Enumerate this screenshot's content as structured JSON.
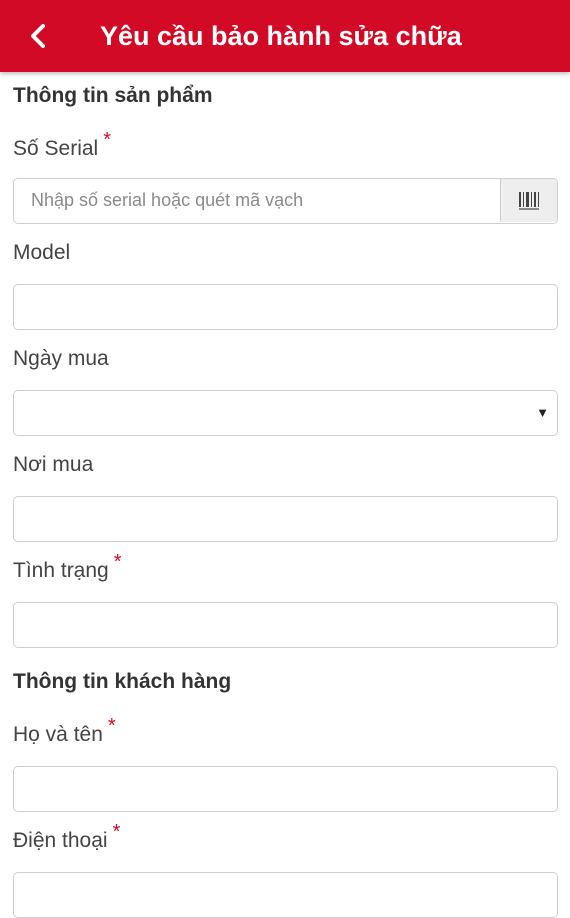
{
  "header": {
    "title": "Yêu cầu bảo hành sửa chữa",
    "back_icon": "chevron-left-icon",
    "background_color": "#d20a26"
  },
  "product_section": {
    "title": "Thông tin sản phẩm",
    "serial": {
      "label": "Số Serial",
      "required_mark": "*",
      "placeholder": "Nhập số serial hoặc quét mã vạch",
      "value": "",
      "scan_icon": "barcode-icon"
    },
    "model": {
      "label": "Model",
      "value": ""
    },
    "purchase_date": {
      "label": "Ngày mua",
      "selected": "",
      "caret_icon": "caret-down-icon"
    },
    "purchase_place": {
      "label": "Nơi mua",
      "value": ""
    },
    "condition": {
      "label": "Tình trạng",
      "required_mark": "*",
      "value": ""
    }
  },
  "customer_section": {
    "title": "Thông tin khách hàng",
    "full_name": {
      "label": "Họ và tên",
      "required_mark": "*",
      "value": ""
    },
    "phone": {
      "label": "Điện thoại",
      "required_mark": "*",
      "value": ""
    }
  },
  "colors": {
    "accent": "#d20a26",
    "required": "#d20a26",
    "border": "#cfcfcf"
  }
}
